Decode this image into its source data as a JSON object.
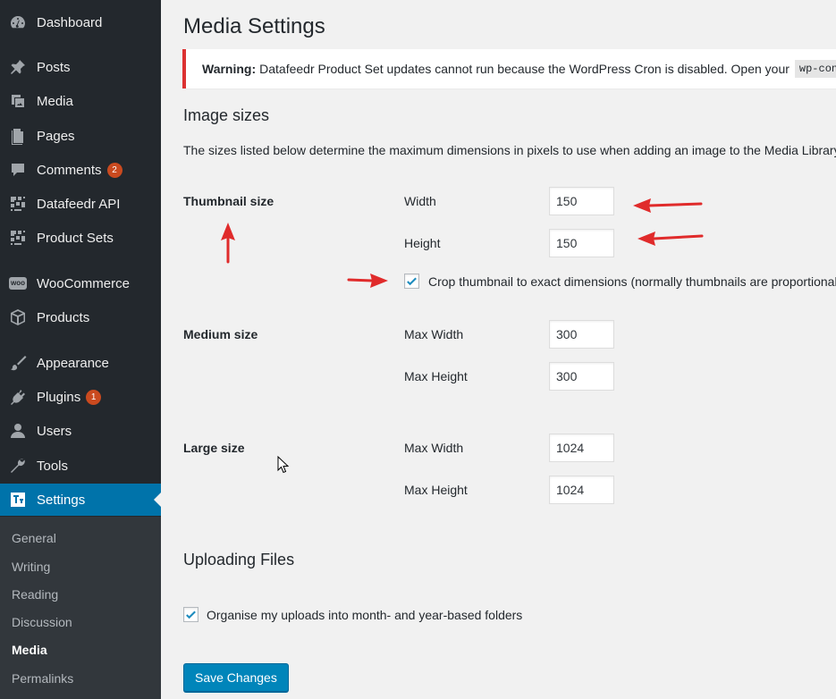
{
  "sidebar": {
    "items": [
      {
        "label": "Dashboard",
        "icon": "dashboard-icon"
      },
      {
        "label": "Posts",
        "icon": "pushpin-icon"
      },
      {
        "label": "Media",
        "icon": "media-icon"
      },
      {
        "label": "Pages",
        "icon": "pages-icon"
      },
      {
        "label": "Comments",
        "icon": "comments-icon",
        "badge": "2"
      },
      {
        "label": "Datafeedr API",
        "icon": "datafeedr-icon"
      },
      {
        "label": "Product Sets",
        "icon": "datafeedr-icon"
      },
      {
        "label": "WooCommerce",
        "icon": "woocommerce-icon"
      },
      {
        "label": "Products",
        "icon": "box-icon"
      },
      {
        "label": "Appearance",
        "icon": "brush-icon"
      },
      {
        "label": "Plugins",
        "icon": "plug-icon",
        "badge": "1"
      },
      {
        "label": "Users",
        "icon": "user-icon"
      },
      {
        "label": "Tools",
        "icon": "wrench-icon"
      },
      {
        "label": "Settings",
        "icon": "settings-icon",
        "current": true
      }
    ],
    "submenu": [
      "General",
      "Writing",
      "Reading",
      "Discussion",
      "Media",
      "Permalinks"
    ],
    "woo_icon_text": "woo"
  },
  "page": {
    "title": "Media Settings",
    "notice": {
      "strong": "Warning:",
      "text": "Datafeedr Product Set updates cannot run because the WordPress Cron is disabled. Open your",
      "code": "wp-config.php"
    },
    "image_sizes": {
      "title": "Image sizes",
      "description": "The sizes listed below determine the maximum dimensions in pixels to use when adding an image to the Media Library.",
      "thumbnail": {
        "label": "Thumbnail size",
        "width_label": "Width",
        "width": "150",
        "height_label": "Height",
        "height": "150",
        "crop_label": "Crop thumbnail to exact dimensions (normally thumbnails are proportional)",
        "crop_checked": true
      },
      "medium": {
        "label": "Medium size",
        "width_label": "Max Width",
        "width": "300",
        "height_label": "Max Height",
        "height": "300"
      },
      "large": {
        "label": "Large size",
        "width_label": "Max Width",
        "width": "1024",
        "height_label": "Max Height",
        "height": "1024"
      }
    },
    "uploading": {
      "title": "Uploading Files",
      "organise_label": "Organise my uploads into month- and year-based folders",
      "organise_checked": true
    },
    "save_label": "Save Changes"
  },
  "colors": {
    "sidebar_bg": "#23282d",
    "submenu_bg": "#32373c",
    "accent": "#0073aa",
    "button": "#0085ba",
    "notice_border": "#dc3232",
    "arrow": "#e02b2b",
    "check": "#1e8cbe"
  }
}
